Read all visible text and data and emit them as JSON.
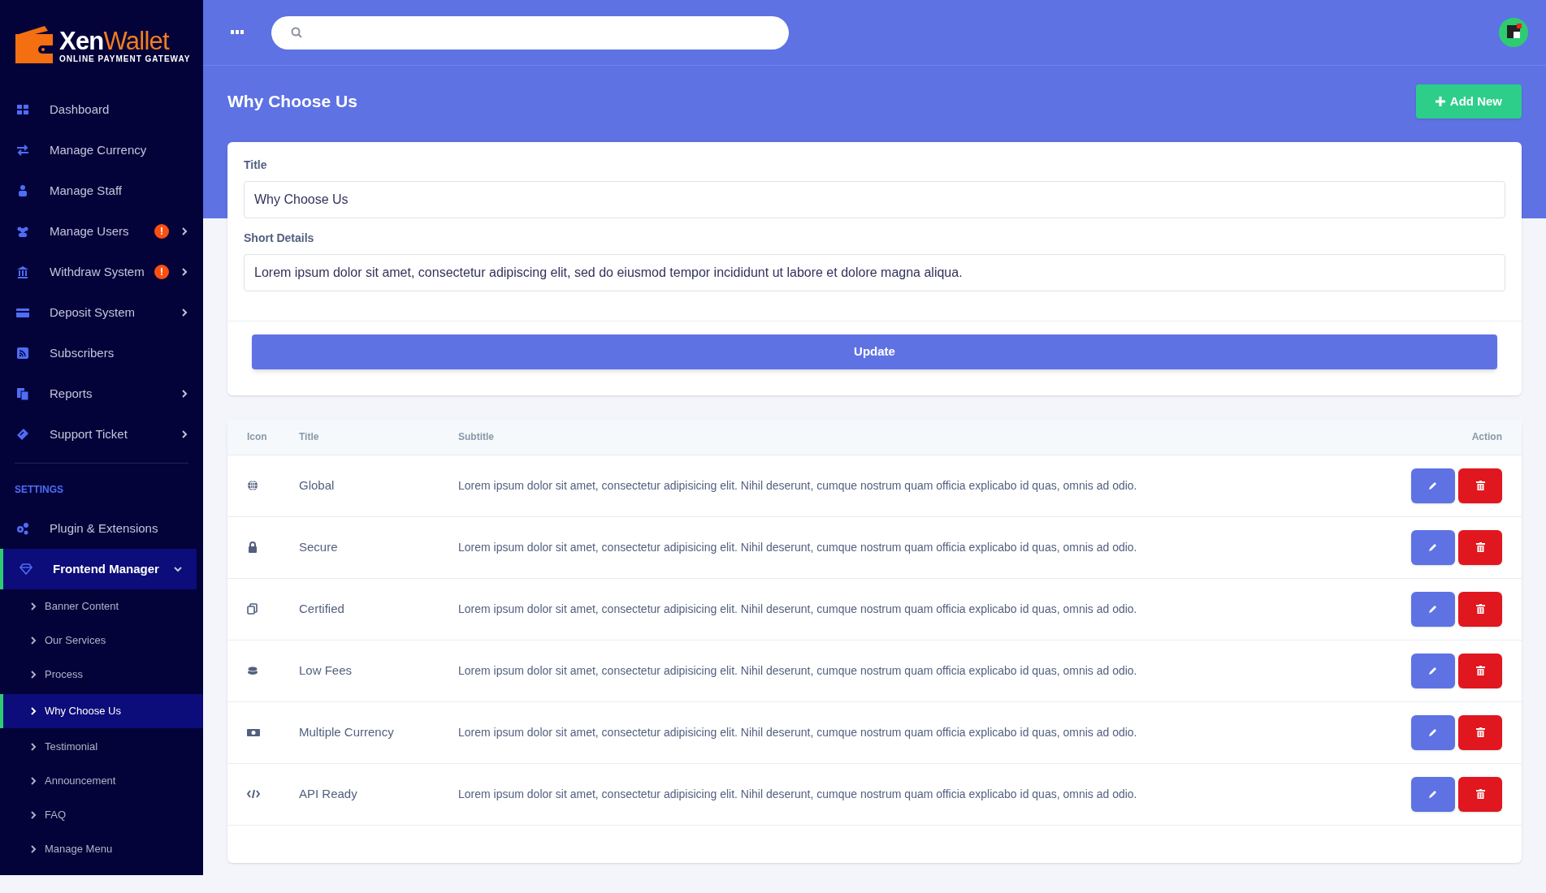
{
  "logo": {
    "name": "**Xen**Wallet",
    "tagline": "ONLINE PAYMENT GATEWAY"
  },
  "sidebar": {
    "items": [
      {
        "label": "Dashboard",
        "selected": false,
        "has_submenu": false
      },
      {
        "label": "Manage Currency",
        "selected": false,
        "has_submenu": false
      },
      {
        "label": "Manage Staff",
        "selected": false,
        "has_submenu": false
      },
      {
        "label": "Manage Users",
        "selected": false,
        "has_submenu": true,
        "expanded": false,
        "badge": "!"
      },
      {
        "label": "Withdraw System",
        "selected": false,
        "has_submenu": true,
        "expanded": false,
        "badge": "!"
      },
      {
        "label": "Deposit System",
        "selected": false,
        "has_submenu": true,
        "expanded": false
      },
      {
        "label": "Subscribers",
        "selected": false,
        "has_submenu": false
      },
      {
        "label": "Reports",
        "selected": false,
        "has_submenu": true,
        "expanded": false
      },
      {
        "label": "Support Ticket",
        "selected": false,
        "has_submenu": true,
        "expanded": false
      }
    ],
    "section_heading": "SETTINGS",
    "settings_items": [
      {
        "label": "Plugin & Extensions",
        "selected": false,
        "has_submenu": false
      },
      {
        "label": "Frontend Manager",
        "selected": true,
        "has_submenu": true,
        "expanded": true,
        "children": [
          {
            "label": "Banner Content",
            "selected": false
          },
          {
            "label": "Our Services",
            "selected": false
          },
          {
            "label": "Process",
            "selected": false
          },
          {
            "label": "Why Choose Us",
            "selected": true
          },
          {
            "label": "Testimonial",
            "selected": false
          },
          {
            "label": "Announcement",
            "selected": false
          },
          {
            "label": "FAQ",
            "selected": false
          },
          {
            "label": "Manage Menu",
            "selected": false
          }
        ]
      }
    ]
  },
  "page_title": "Why Choose Us",
  "add_button": "Add New",
  "form": {
    "fields": [
      {
        "label": "Title",
        "value": "Why Choose Us"
      },
      {
        "label": "Short Details",
        "value": "Lorem ipsum dolor sit amet, consectetur adipiscing elit, sed do eiusmod tempor incididunt ut labore et dolore magna aliqua."
      }
    ],
    "submit": "Update"
  },
  "table": {
    "columns": [
      "Icon",
      "Title",
      "Subtitle",
      "Action"
    ],
    "rows": [
      {
        "title": "Global",
        "subtitle": "Lorem ipsum dolor sit amet, consectetur adipisicing elit. Nihil deserunt, cumque nostrum quam officia explicabo id quas, omnis ad odio."
      },
      {
        "title": "Secure",
        "subtitle": "Lorem ipsum dolor sit amet, consectetur adipisicing elit. Nihil deserunt, cumque nostrum quam officia explicabo id quas, omnis ad odio."
      },
      {
        "title": "Certified",
        "subtitle": "Lorem ipsum dolor sit amet, consectetur adipisicing elit. Nihil deserunt, cumque nostrum quam officia explicabo id quas, omnis ad odio."
      },
      {
        "title": "Low Fees",
        "subtitle": "Lorem ipsum dolor sit amet, consectetur adipisicing elit. Nihil deserunt, cumque nostrum quam officia explicabo id quas, omnis ad odio."
      },
      {
        "title": "Multiple Currency",
        "subtitle": "Lorem ipsum dolor sit amet, consectetur adipisicing elit. Nihil deserunt, cumque nostrum quam officia explicabo id quas, omnis ad odio."
      },
      {
        "title": "API Ready",
        "subtitle": "Lorem ipsum dolor sit amet, consectetur adipisicing elit. Nihil deserunt, cumque nostrum quam officia explicabo id quas, omnis ad odio."
      }
    ]
  }
}
